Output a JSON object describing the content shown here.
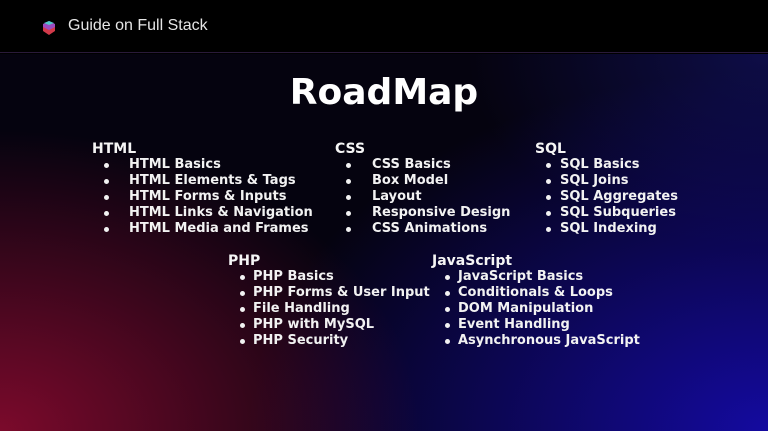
{
  "header": {
    "title": "Guide on Full Stack",
    "logo_icon": "stacked-layers-logo"
  },
  "main": {
    "title": "RoadMap",
    "groups": [
      {
        "heading": "HTML",
        "items": [
          "HTML Basics",
          "HTML Elements & Tags",
          "HTML Forms & Inputs",
          "HTML Links & Navigation",
          "HTML Media and Frames"
        ]
      },
      {
        "heading": "CSS",
        "items": [
          "CSS Basics",
          "Box Model",
          "Layout",
          "Responsive Design",
          "CSS Animations"
        ]
      },
      {
        "heading": "SQL",
        "items": [
          "SQL Basics",
          "SQL Joins",
          "SQL Aggregates",
          "SQL Subqueries",
          "SQL Indexing"
        ]
      },
      {
        "heading": "PHP",
        "items": [
          "PHP Basics",
          "PHP Forms & User Input",
          "File Handling",
          "PHP with MySQL",
          "PHP Security"
        ]
      },
      {
        "heading": "JavaScript",
        "items": [
          "JavaScript Basics",
          "Conditionals & Loops",
          "DOM Manipulation",
          "Event Handling",
          "Asynchronous JavaScript"
        ]
      }
    ]
  }
}
